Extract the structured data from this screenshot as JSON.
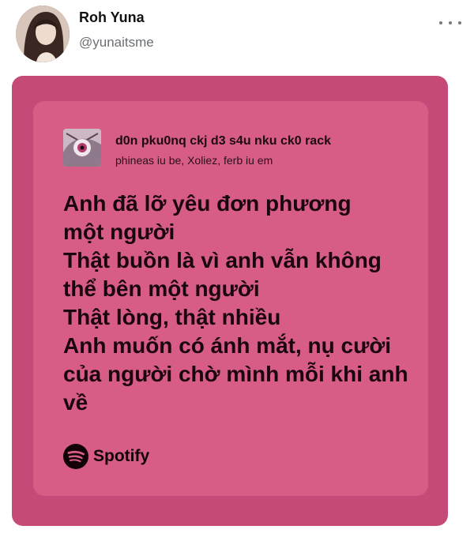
{
  "post": {
    "author_name": "Roh Yuna",
    "author_handle": "@yunaitsme",
    "more_icon": "more-horizontal-icon"
  },
  "card": {
    "track_title": "d0n pku0nq ckj d3 s4u nku ck0 rack",
    "track_artists": "phineas iu be, Xoliez, ferb iu em",
    "lyrics": [
      "Anh đã lỡ yêu đơn phương",
      "một người",
      "Thật buồn là vì anh vẫn không",
      "thể bên một người",
      "Thật lòng, thật nhiều",
      "Anh muốn có ánh mắt, nụ cười",
      "của người chờ mình mỗi khi anh",
      "về"
    ],
    "brand": "Spotify",
    "brand_icon": "spotify-logo-icon"
  },
  "colors": {
    "card_outer": "#c64a78",
    "card_inner": "#d75d87",
    "text_dark": "#1a0510"
  }
}
